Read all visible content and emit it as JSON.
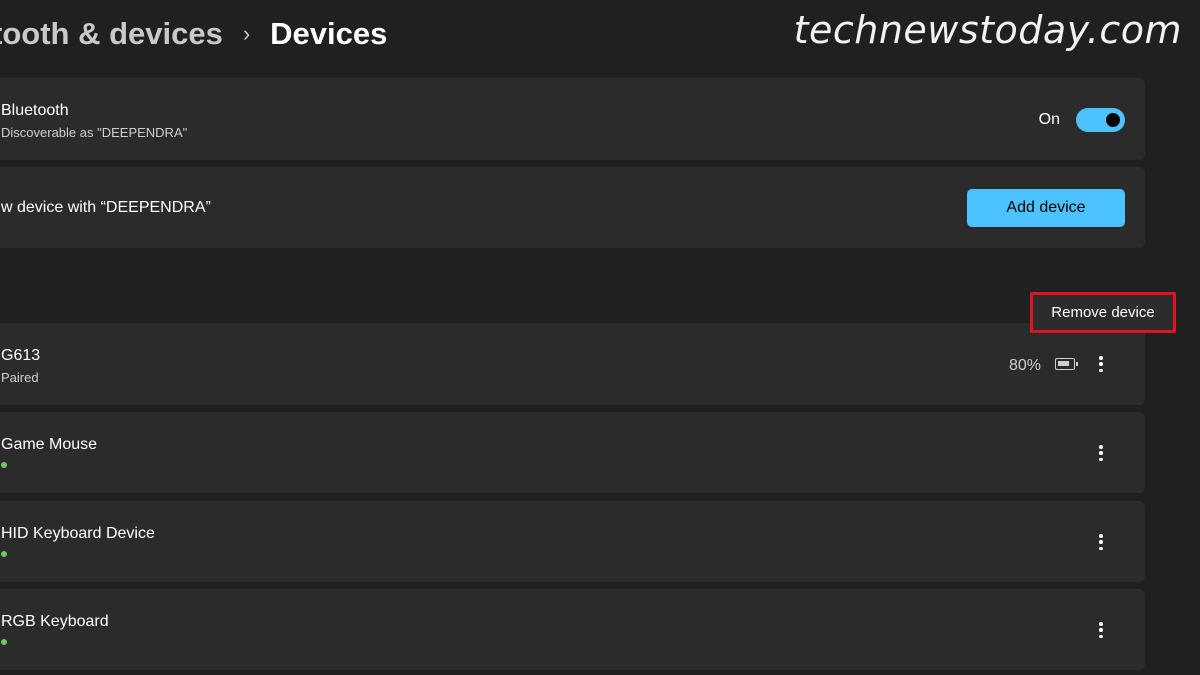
{
  "breadcrumb": {
    "parent": "tooth & devices",
    "separator": "›",
    "current": "Devices"
  },
  "watermark": "technewstoday.com",
  "bluetooth": {
    "title": "Bluetooth",
    "subtitle": "Discoverable as \"DEEPENDRA\"",
    "toggle_label": "On",
    "toggle_state": "on"
  },
  "add_device": {
    "title": "w device with “DEEPENDRA”",
    "button_label": "Add device"
  },
  "context_menu": {
    "item_label": "Remove device"
  },
  "devices": [
    {
      "name": "G613",
      "status": "Paired",
      "battery": "80%",
      "icon": "more-vertical-icon"
    },
    {
      "name": "Game Mouse",
      "connected": true,
      "icon": "more-vertical-icon"
    },
    {
      "name": "HID Keyboard Device",
      "connected": true,
      "icon": "more-vertical-icon"
    },
    {
      "name": "RGB Keyboard",
      "connected": true,
      "icon": "more-vertical-icon"
    }
  ],
  "colors": {
    "accent": "#4cc2ff",
    "highlight_box": "#e0141e",
    "connected_dot": "#6ccb5f",
    "background": "#202020",
    "card": "#2b2b2b"
  }
}
